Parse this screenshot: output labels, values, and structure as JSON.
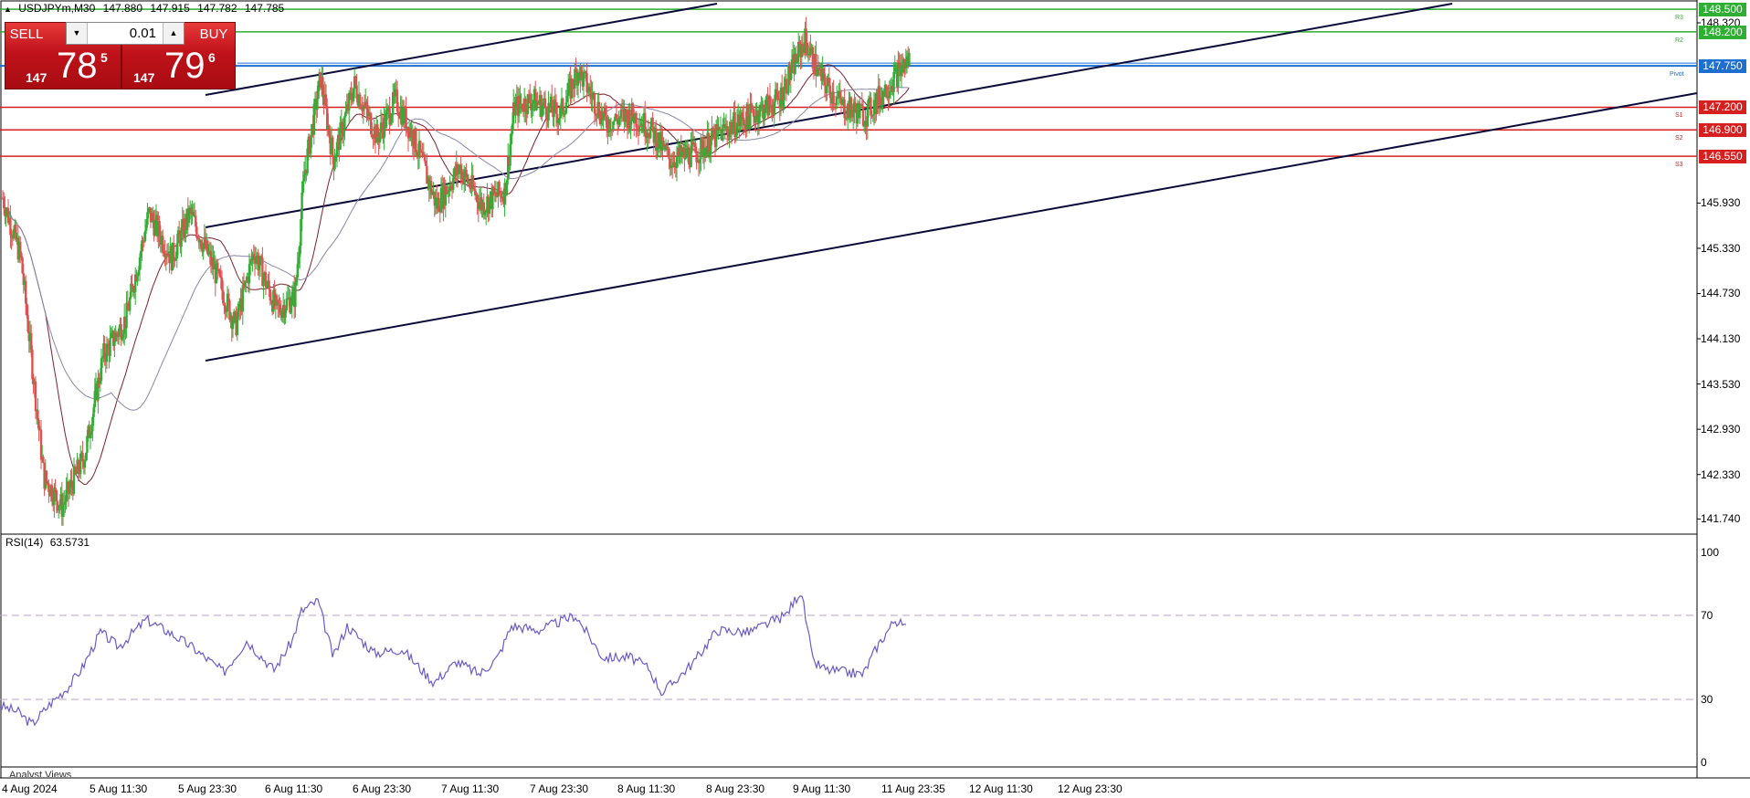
{
  "header": {
    "symbol": "USDJPYm,M30",
    "open": "147.880",
    "high": "147.915",
    "low": "147.782",
    "close": "147.785"
  },
  "trade_panel": {
    "sell_label": "SELL",
    "buy_label": "BUY",
    "lot_value": "0.01",
    "sell_price_prefix": "147",
    "sell_price_big": "78",
    "sell_price_pip": "5",
    "buy_price_prefix": "147",
    "buy_price_big": "79",
    "buy_price_pip": "6"
  },
  "price_axis": {
    "ticks": [
      "148.320",
      "145.930",
      "145.330",
      "144.730",
      "144.130",
      "143.530",
      "142.930",
      "142.330",
      "141.740"
    ],
    "badges": [
      {
        "value": "148.500",
        "color": "#2eae32"
      },
      {
        "value": "148.200",
        "color": "#2eae32"
      },
      {
        "value": "147.750",
        "color": "#1e6fd0"
      },
      {
        "value": "147.200",
        "color": "#d62020"
      },
      {
        "value": "146.900",
        "color": "#d62020"
      },
      {
        "value": "146.550",
        "color": "#d62020"
      }
    ]
  },
  "pivot_labels": {
    "r3": "R3",
    "r2": "R2",
    "pivot": "Pivot",
    "s1": "S1",
    "s2": "S2",
    "s3": "S3"
  },
  "rsi": {
    "title": "RSI(14)",
    "value": "63.5731",
    "ticks": [
      "100",
      "70",
      "30",
      "0"
    ]
  },
  "time_axis": [
    "4 Aug 2024",
    "5 Aug 11:30",
    "5 Aug 23:30",
    "6 Aug 11:30",
    "6 Aug 23:30",
    "7 Aug 11:30",
    "7 Aug 23:30",
    "8 Aug 11:30",
    "8 Aug 23:30",
    "9 Aug 11:30",
    "11 Aug 23:35",
    "12 Aug 11:30",
    "12 Aug 23:30"
  ],
  "analyst_views": "Analyst Views",
  "colors": {
    "bull": "#2eae32",
    "bear": "#e05050",
    "resistance": "#2eae32",
    "pivot": "#1e6fd0",
    "support": "#d62020",
    "channel": "#0a0a3a",
    "rsi_line": "#6a5acd",
    "ma_fast": "#7a2030",
    "ma_slow": "#8888aa"
  },
  "chart_data": {
    "type": "candlestick",
    "symbol": "USDJPYm",
    "timeframe": "M30",
    "ylim": [
      141.6,
      148.55
    ],
    "levels": [
      {
        "label": "R3",
        "value": 148.5
      },
      {
        "label": "R2",
        "value": 148.2
      },
      {
        "label": "Pivot",
        "value": 147.75
      },
      {
        "label": "S1",
        "value": 147.2
      },
      {
        "label": "S2",
        "value": 146.9
      },
      {
        "label": "S3",
        "value": 146.55
      }
    ],
    "price_path": [
      [
        0,
        146.0
      ],
      [
        20,
        145.2
      ],
      [
        45,
        142.3
      ],
      [
        65,
        141.9
      ],
      [
        90,
        142.6
      ],
      [
        110,
        143.9
      ],
      [
        135,
        144.4
      ],
      [
        160,
        145.8
      ],
      [
        185,
        145.2
      ],
      [
        205,
        145.8
      ],
      [
        230,
        145.1
      ],
      [
        255,
        144.3
      ],
      [
        275,
        145.3
      ],
      [
        300,
        144.5
      ],
      [
        320,
        144.7
      ],
      [
        330,
        146.3
      ],
      [
        348,
        147.6
      ],
      [
        362,
        146.5
      ],
      [
        385,
        147.5
      ],
      [
        410,
        146.8
      ],
      [
        430,
        147.3
      ],
      [
        450,
        146.8
      ],
      [
        475,
        145.9
      ],
      [
        500,
        146.4
      ],
      [
        525,
        145.9
      ],
      [
        550,
        146.1
      ],
      [
        560,
        147.2
      ],
      [
        580,
        147.3
      ],
      [
        610,
        147.1
      ],
      [
        630,
        147.7
      ],
      [
        660,
        147.0
      ],
      [
        690,
        147.1
      ],
      [
        710,
        146.9
      ],
      [
        730,
        146.5
      ],
      [
        760,
        146.6
      ],
      [
        790,
        146.9
      ],
      [
        820,
        147.1
      ],
      [
        850,
        147.3
      ],
      [
        878,
        148.1
      ],
      [
        895,
        147.6
      ],
      [
        920,
        147.2
      ],
      [
        945,
        147.1
      ],
      [
        970,
        147.5
      ],
      [
        993,
        147.85
      ]
    ],
    "rsi": {
      "levels": [
        70,
        30
      ],
      "ylim": [
        0,
        100
      ],
      "path": [
        [
          0,
          27
        ],
        [
          20,
          24
        ],
        [
          35,
          18
        ],
        [
          55,
          28
        ],
        [
          75,
          36
        ],
        [
          90,
          45
        ],
        [
          110,
          62
        ],
        [
          130,
          55
        ],
        [
          160,
          68
        ],
        [
          185,
          62
        ],
        [
          210,
          55
        ],
        [
          245,
          43
        ],
        [
          270,
          58
        ],
        [
          300,
          44
        ],
        [
          320,
          58
        ],
        [
          330,
          72
        ],
        [
          348,
          77
        ],
        [
          365,
          50
        ],
        [
          380,
          65
        ],
        [
          410,
          52
        ],
        [
          440,
          54
        ],
        [
          475,
          38
        ],
        [
          500,
          48
        ],
        [
          525,
          42
        ],
        [
          545,
          50
        ],
        [
          560,
          65
        ],
        [
          590,
          63
        ],
        [
          630,
          70
        ],
        [
          660,
          50
        ],
        [
          690,
          50
        ],
        [
          710,
          45
        ],
        [
          725,
          33
        ],
        [
          760,
          48
        ],
        [
          785,
          63
        ],
        [
          820,
          62
        ],
        [
          860,
          70
        ],
        [
          877,
          82
        ],
        [
          890,
          48
        ],
        [
          905,
          44
        ],
        [
          945,
          42
        ],
        [
          960,
          55
        ],
        [
          980,
          68
        ],
        [
          993,
          63.57
        ]
      ]
    }
  }
}
